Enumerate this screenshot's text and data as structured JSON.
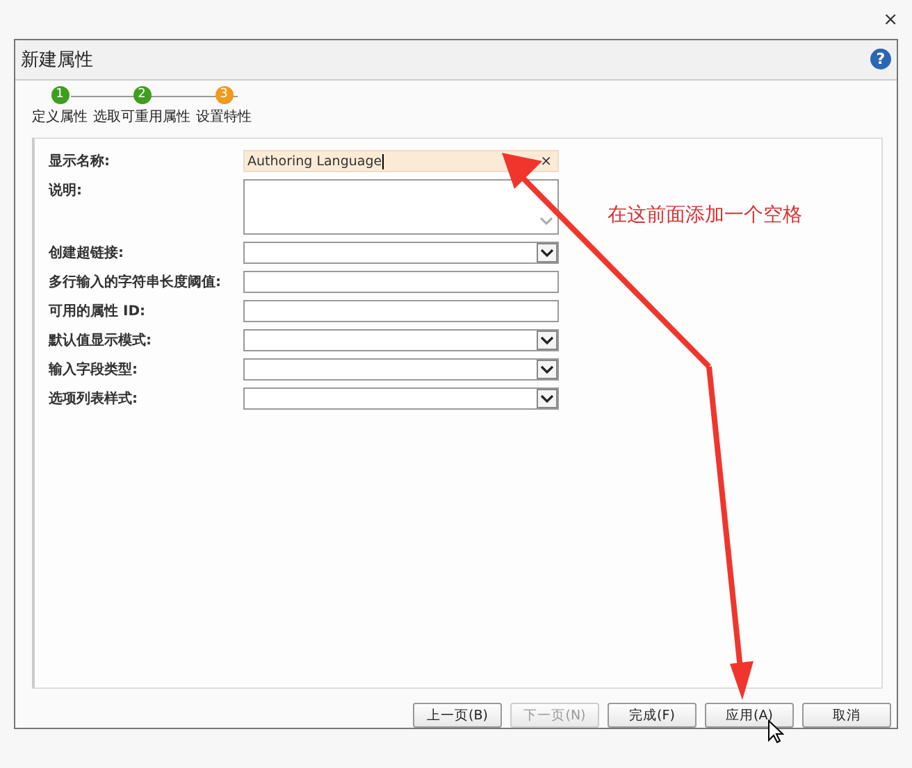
{
  "window": {
    "close": "×"
  },
  "dialog": {
    "title": "新建属性",
    "help": "?"
  },
  "steps": [
    {
      "number": "1",
      "label": "定义属性",
      "current": false
    },
    {
      "number": "2",
      "label": "选取可重用属性",
      "current": false
    },
    {
      "number": "3",
      "label": "设置特性",
      "current": true
    }
  ],
  "fields": [
    {
      "label": "显示名称:",
      "kind": "text",
      "value": "Authoring Language",
      "focused": true,
      "clear": "×"
    },
    {
      "label": "说明:",
      "kind": "textarea",
      "focused": false
    },
    {
      "label": "创建超链接:",
      "kind": "select",
      "focused": false
    },
    {
      "label": "多行输入的字符串长度阈值:",
      "kind": "text",
      "focused": false
    },
    {
      "label": "可用的属性 ID:",
      "kind": "text",
      "focused": false
    },
    {
      "label": "默认值显示模式:",
      "kind": "select",
      "focused": false
    },
    {
      "label": "输入字段类型:",
      "kind": "select",
      "focused": false
    },
    {
      "label": "选项列表样式:",
      "kind": "select",
      "focused": false
    }
  ],
  "annotation": {
    "note": "在这前面添加一个空格"
  },
  "buttons": [
    {
      "label": "上一页(B)",
      "disabled": false
    },
    {
      "label": "下一页(N)",
      "disabled": true
    },
    {
      "label": "完成(F)",
      "disabled": false
    },
    {
      "label": "应用(A)",
      "disabled": false
    },
    {
      "label": "取消",
      "disabled": false
    }
  ]
}
